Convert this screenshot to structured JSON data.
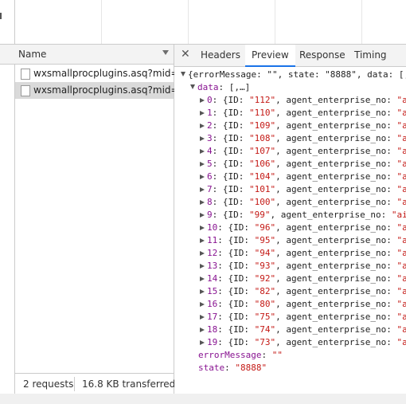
{
  "request_list": {
    "column_name": "Name",
    "requests": [
      "wxsmallprocplugins.asq?mid=...",
      "wxsmallprocplugins.asq?mid=..."
    ],
    "status_requests": "2 requests",
    "status_transferred": "16.8 KB transferred"
  },
  "details": {
    "tabs": [
      "Headers",
      "Preview",
      "Response",
      "Timing"
    ],
    "active_tab": "Preview",
    "root_line": "{errorMessage: \"\", state: \"8888\", data: [,",
    "data_key": "data",
    "data_summary": "[,…]",
    "items": [
      {
        "index": "0",
        "id": "\"112\"",
        "next_key": "agent_enterprise_no",
        "tail": "\"a"
      },
      {
        "index": "1",
        "id": "\"110\"",
        "next_key": "agent_enterprise_no",
        "tail": "\"a"
      },
      {
        "index": "2",
        "id": "\"109\"",
        "next_key": "agent_enterprise_no",
        "tail": "\"a"
      },
      {
        "index": "3",
        "id": "\"108\"",
        "next_key": "agent_enterprise_no",
        "tail": "\"a"
      },
      {
        "index": "4",
        "id": "\"107\"",
        "next_key": "agent_enterprise_no",
        "tail": "\"a"
      },
      {
        "index": "5",
        "id": "\"106\"",
        "next_key": "agent_enterprise_no",
        "tail": "\"a"
      },
      {
        "index": "6",
        "id": "\"104\"",
        "next_key": "agent_enterprise_no",
        "tail": "\"a"
      },
      {
        "index": "7",
        "id": "\"101\"",
        "next_key": "agent_enterprise_no",
        "tail": "\"a"
      },
      {
        "index": "8",
        "id": "\"100\"",
        "next_key": "agent_enterprise_no",
        "tail": "\"a"
      },
      {
        "index": "9",
        "id": "\"99\"",
        "next_key": "agent_enterprise_no",
        "tail": "\"ai"
      },
      {
        "index": "10",
        "id": "\"96\"",
        "next_key": "agent_enterprise_no",
        "tail": "\"a"
      },
      {
        "index": "11",
        "id": "\"95\"",
        "next_key": "agent_enterprise_no",
        "tail": "\"a"
      },
      {
        "index": "12",
        "id": "\"94\"",
        "next_key": "agent_enterprise_no",
        "tail": "\"a"
      },
      {
        "index": "13",
        "id": "\"93\"",
        "next_key": "agent_enterprise_no",
        "tail": "\"a"
      },
      {
        "index": "14",
        "id": "\"92\"",
        "next_key": "agent_enterprise_no",
        "tail": "\"a"
      },
      {
        "index": "15",
        "id": "\"82\"",
        "next_key": "agent_enterprise_no",
        "tail": "\"a"
      },
      {
        "index": "16",
        "id": "\"80\"",
        "next_key": "agent_enterprise_no",
        "tail": "\"a"
      },
      {
        "index": "17",
        "id": "\"75\"",
        "next_key": "agent_enterprise_no",
        "tail": "\"a"
      },
      {
        "index": "18",
        "id": "\"74\"",
        "next_key": "agent_enterprise_no",
        "tail": "\"a"
      },
      {
        "index": "19",
        "id": "\"73\"",
        "next_key": "agent_enterprise_no",
        "tail": "\"a"
      }
    ],
    "error_message_key": "errorMessage",
    "error_message_value": "\"\"",
    "state_key": "state",
    "state_value": "\"8888\""
  },
  "colors": {
    "accent": "#1a73e8",
    "json_key": "#881391",
    "json_string": "#c41a16",
    "selected_row": "#dadada"
  }
}
